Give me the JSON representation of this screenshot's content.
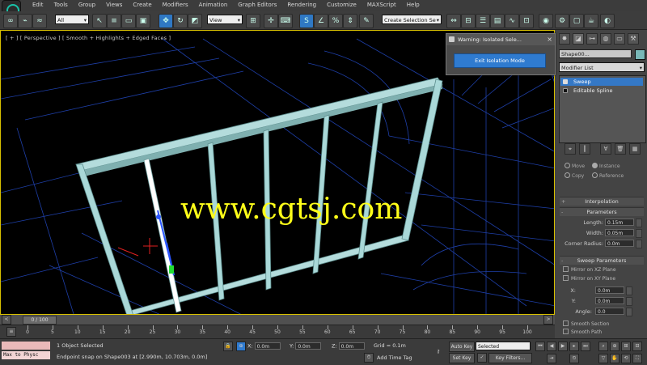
{
  "menu": {
    "items": [
      "Edit",
      "Tools",
      "Group",
      "Views",
      "Create",
      "Modifiers",
      "Animation",
      "Graph Editors",
      "Rendering",
      "Customize",
      "MAXScript",
      "Help"
    ]
  },
  "toolbar": {
    "filter_value": "All",
    "refcoord_value": "View",
    "named_selection": "Create Selection Se"
  },
  "viewport": {
    "label": "[ + ] [ Perspective ] [ Smooth + Highlights + Edged Faces ]",
    "watermark": "www.cgtsj.com"
  },
  "isolation_dialog": {
    "title": "Warning: Isolated Sele...",
    "button": "Exit Isolation Mode"
  },
  "command_panel": {
    "object_name": "Shape00...",
    "modifier_list": "Modifier List",
    "stack": [
      {
        "label": "Sweep",
        "selected": true
      },
      {
        "label": "Editable Spline",
        "selected": false
      }
    ],
    "radios": [
      "Move",
      "Instance",
      "Copy",
      "Reference"
    ],
    "rollout_interpolation": "Interpolation",
    "rollout_parameters": "Parameters",
    "params": [
      {
        "label": "Length:",
        "value": "0.15m"
      },
      {
        "label": "Width:",
        "value": "0.05m"
      },
      {
        "label": "Corner Radius:",
        "value": "0.0m"
      }
    ],
    "sweep_params_title": "Sweep Parameters",
    "mirror_xz": "Mirror on XZ Plane",
    "mirror_xy": "Mirror on XY Plane",
    "offsets": [
      {
        "label": "X:",
        "value": "0.0m"
      },
      {
        "label": "Y:",
        "value": "0.0m"
      },
      {
        "label": "Angle:",
        "value": "0.0"
      }
    ],
    "smooth_section": "Smooth Section",
    "smooth_path": "Smooth Path"
  },
  "timeline": {
    "slider": "0 / 100",
    "ticks": [
      "0",
      "5",
      "10",
      "15",
      "20",
      "25",
      "30",
      "35",
      "40",
      "45",
      "50",
      "55",
      "60",
      "65",
      "70",
      "75",
      "80",
      "85",
      "90",
      "95",
      "100"
    ]
  },
  "status": {
    "maxscript": "Max to Physc",
    "selection_info": "1 Object Selected",
    "prompt": "Endpoint snap on Shape003 at [2.990m, 10.703m, 0.0m]",
    "x_label": "X:",
    "x_value": "0.0m",
    "y_label": "Y:",
    "y_value": "0.0m",
    "z_label": "Z:",
    "z_value": "0.0m",
    "grid": "Grid = 0.1m",
    "add_time_tag": "Add Time Tag",
    "auto_key": "Auto Key",
    "set_key": "Set Key",
    "selected": "Selected",
    "key_filters": "Key Filters..."
  },
  "colors": {
    "accent": "#2f7bd0",
    "viewport_border": "#d8c000",
    "watermark": "#ffff19",
    "frame": "#a9d8d8",
    "wire": "#1e3fa8",
    "object_color": "#79b8b8"
  }
}
